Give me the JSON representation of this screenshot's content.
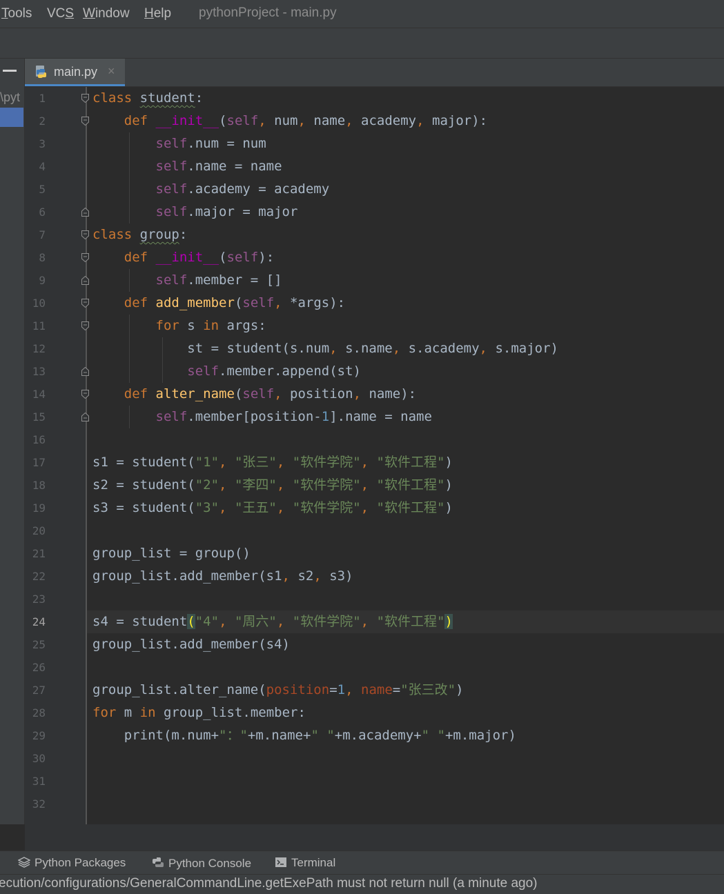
{
  "menubar": {
    "items": [
      {
        "label": "Tools",
        "mnemonic": "T"
      },
      {
        "label": "VCS",
        "mnemonic": "S"
      },
      {
        "label": "Window",
        "mnemonic": "W"
      },
      {
        "label": "Help",
        "mnemonic": "H"
      }
    ],
    "title": "pythonProject - main.py"
  },
  "project_panel": {
    "path_fragment": "\\pyt"
  },
  "editor_tab": {
    "label": "main.py",
    "close_glyph": "×",
    "icon": "python-file-icon"
  },
  "editor": {
    "current_line": 24,
    "line_numbers": [
      "1",
      "2",
      "3",
      "4",
      "5",
      "6",
      "7",
      "8",
      "9",
      "10",
      "11",
      "12",
      "13",
      "14",
      "15",
      "16",
      "17",
      "18",
      "19",
      "20",
      "21",
      "22",
      "23",
      "24",
      "25",
      "26",
      "27",
      "28",
      "29",
      "30",
      "31",
      "32"
    ],
    "lines": [
      "class student:",
      "    def __init__(self, num, name, academy, major):",
      "        self.num = num",
      "        self.name = name",
      "        self.academy = academy",
      "        self.major = major",
      "class group:",
      "    def __init__(self):",
      "        self.member = []",
      "    def add_member(self, *args):",
      "        for s in args:",
      "            st = student(s.num, s.name, s.academy, s.major)",
      "            self.member.append(st)",
      "    def alter_name(self, position, name):",
      "        self.member[position-1].name = name",
      "",
      "s1 = student(\"1\", \"张三\", \"软件学院\", \"软件工程\")",
      "s2 = student(\"2\", \"李四\", \"软件学院\", \"软件工程\")",
      "s3 = student(\"3\", \"王五\", \"软件学院\", \"软件工程\")",
      "",
      "group_list = group()",
      "group_list.add_member(s1, s2, s3)",
      "",
      "s4 = student(\"4\", \"周六\", \"软件学院\", \"软件工程\")",
      "group_list.add_member(s4)",
      "",
      "group_list.alter_name(position=1, name=\"张三改\")",
      "for m in group_list.member:",
      "    print(m.num+\"：\"+m.name+\" \"+m.academy+\" \"+m.major)",
      "",
      "",
      ""
    ]
  },
  "bottom_tabs": [
    {
      "label": "Python Packages",
      "icon": "layers-icon"
    },
    {
      "label": "Python Console",
      "icon": "python-console-icon"
    },
    {
      "label": "Terminal",
      "icon": "terminal-icon"
    }
  ],
  "status_bar": {
    "message": "ecution/configurations/GeneralCommandLine.getExePath must not return null (a minute ago)"
  },
  "colors": {
    "background": "#2b2b2b",
    "keyword": "#cc7832",
    "self": "#94558d",
    "function": "#ffc66d",
    "magic": "#b200b2",
    "string": "#6a8759",
    "number": "#6897bb",
    "param": "#aa4926",
    "selection": "#4b6eaf"
  }
}
